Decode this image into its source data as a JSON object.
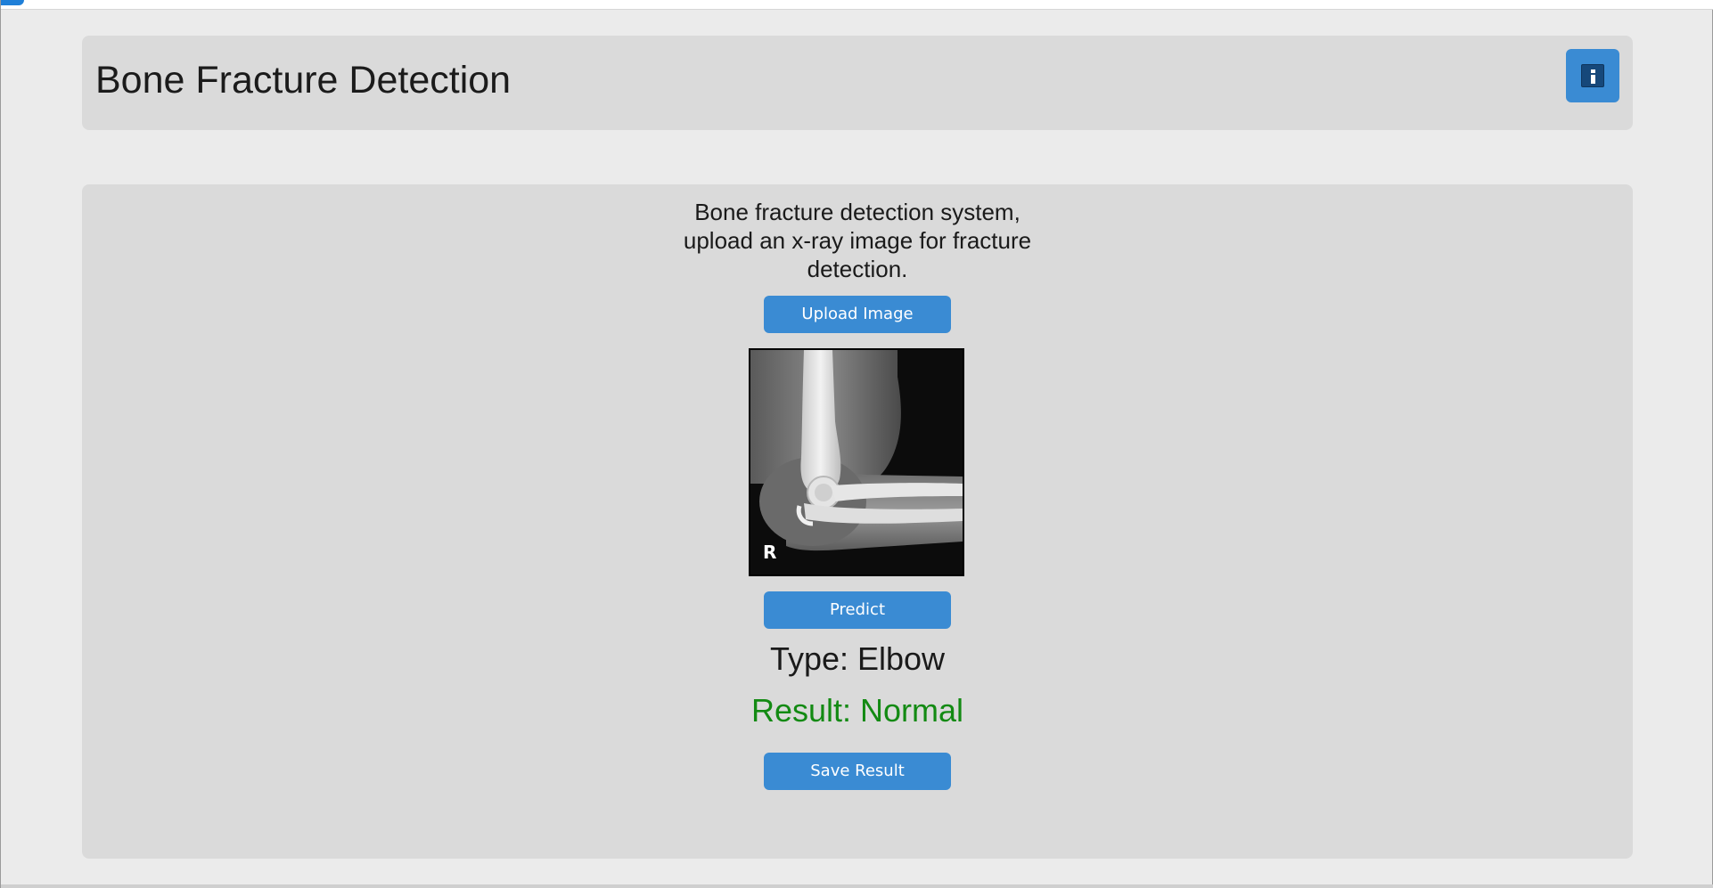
{
  "window": {
    "accent_color": "#1f7fd8"
  },
  "header": {
    "title": "Bone Fracture Detection",
    "info_icon": "info-icon",
    "button_color": "#3a8bd3"
  },
  "main": {
    "description": "Bone fracture detection system, upload an x-ray image for fracture detection.",
    "upload_label": "Upload Image",
    "image": {
      "marker_letter": "R",
      "subject": "elbow x-ray"
    },
    "predict_label": "Predict",
    "type_text": "Type: Elbow",
    "result_text": "Result: Normal",
    "result_color": "#138a13",
    "save_label": "Save Result"
  }
}
